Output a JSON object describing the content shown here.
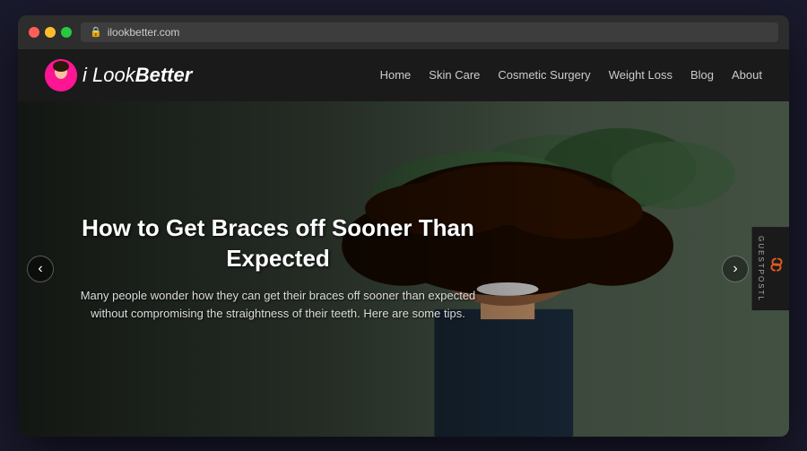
{
  "browser": {
    "url": "ilookbetter.com",
    "traffic_lights": [
      "close",
      "minimize",
      "maximize"
    ]
  },
  "navbar": {
    "logo_text_part1": "i Look",
    "logo_text_part2": "Better",
    "links": [
      {
        "label": "Home",
        "id": "home"
      },
      {
        "label": "Skin Care",
        "id": "skin-care"
      },
      {
        "label": "Cosmetic Surgery",
        "id": "cosmetic-surgery"
      },
      {
        "label": "Weight Loss",
        "id": "weight-loss"
      },
      {
        "label": "Blog",
        "id": "blog"
      },
      {
        "label": "About",
        "id": "about"
      }
    ]
  },
  "hero": {
    "title": "How to Get Braces off Sooner Than Expected",
    "description": "Many people wonder how they can get their braces off sooner than expected without compromising the straightness of their teeth. Here are some tips.",
    "prev_arrow": "‹",
    "next_arrow": "›"
  },
  "sidebar": {
    "guestpost_label": "GUESTPOSTL"
  }
}
